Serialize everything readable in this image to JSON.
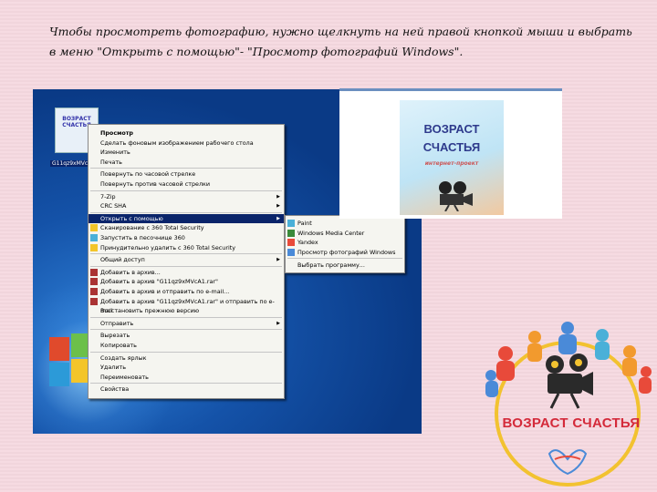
{
  "caption": "Чтобы просмотреть фотографию, нужно щелкнуть на ней правой кнопкой мыши и выбрать в меню \"Открыть с помощью\"- \"Просмотр фотографий Windows\".",
  "desktop": {
    "file_icon_text": "ВОЗРАСТ СЧАСТЬЯ",
    "file_label": "G11qz9xMVcA1"
  },
  "context_menu": {
    "items": [
      {
        "label": "Просмотр",
        "bold": true
      },
      {
        "label": "Сделать фоновым изображением рабочего стола"
      },
      {
        "label": "Изменить"
      },
      {
        "label": "Печать"
      },
      {
        "label": "Повернуть по часовой стрелке"
      },
      {
        "label": "Повернуть против часовой стрелки"
      },
      {
        "label": "7-Zip",
        "submenu": true
      },
      {
        "label": "CRC SHA",
        "submenu": true
      },
      {
        "label": "Открыть с помощью",
        "submenu": true,
        "selected": true
      },
      {
        "label": "Сканирование с 360 Total Security"
      },
      {
        "label": "Запустить в песочнице 360"
      },
      {
        "label": "Принудительно удалить с 360 Total Security"
      },
      {
        "label": "Общий доступ",
        "submenu": true
      },
      {
        "label": "Добавить в архив..."
      },
      {
        "label": "Добавить в архив \"G11qz9xMVcA1.rar\""
      },
      {
        "label": "Добавить в архив и отправить по e-mail..."
      },
      {
        "label": "Добавить в архив \"G11qz9xMVcA1.rar\" и отправить по e-mail"
      },
      {
        "label": "Восстановить прежнюю версию"
      },
      {
        "label": "Отправить",
        "submenu": true
      },
      {
        "label": "Вырезать"
      },
      {
        "label": "Копировать"
      },
      {
        "label": "Создать ярлык"
      },
      {
        "label": "Удалить"
      },
      {
        "label": "Переименовать"
      },
      {
        "label": "Свойства"
      }
    ]
  },
  "submenu": {
    "items": [
      {
        "label": "Paint"
      },
      {
        "label": "Windows Media Center"
      },
      {
        "label": "Yandex"
      },
      {
        "label": "Просмотр фотографий Windows"
      },
      {
        "label": "Выбрать программу..."
      }
    ]
  },
  "viewer": {
    "line1": "ВОЗРАСТ",
    "line2": "СЧАСТЬЯ",
    "line3": "интернет-проект"
  },
  "logo": {
    "text": "ВОЗРАСТ СЧАСТЬЯ"
  }
}
